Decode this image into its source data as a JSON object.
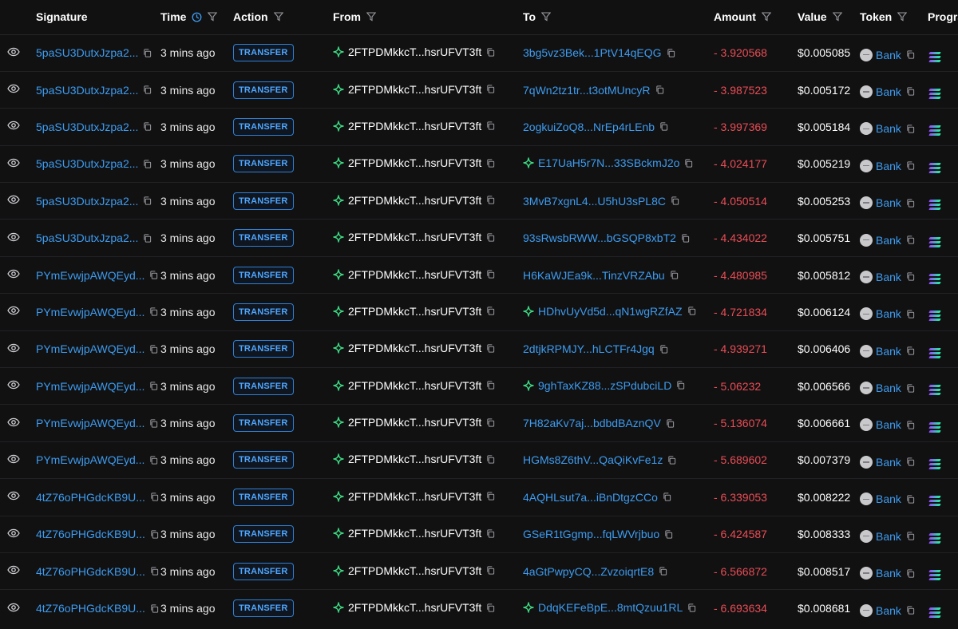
{
  "header": {
    "signature": "Signature",
    "time": "Time",
    "action": "Action",
    "from": "From",
    "to": "To",
    "amount": "Amount",
    "value": "Value",
    "token": "Token",
    "program": "Progra"
  },
  "icons": {
    "view": "eye-icon",
    "copy": "copy-icon",
    "filter": "filter-icon",
    "clock": "clock-icon",
    "wallet_verified": "sparkle-icon",
    "token": "bank-token-icon",
    "program": "solana-icon"
  },
  "colors": {
    "link": "#3d9cf0",
    "negative": "#ea4d55",
    "badge": "#2f7fd4",
    "verified": "#3ddc84",
    "background": "#111112"
  },
  "rows": [
    {
      "signature": "5paSU3DutxJzpa2...",
      "time": "3 mins ago",
      "action": "TRANSFER",
      "from": "2FTPDMkkcT...hsrUFVT3ft",
      "to": "3bg5vz3Bek...1PtV14qEQG",
      "to_verified": false,
      "amount": "- 3.920568",
      "value": "$0.005085",
      "token": "Bank"
    },
    {
      "signature": "5paSU3DutxJzpa2...",
      "time": "3 mins ago",
      "action": "TRANSFER",
      "from": "2FTPDMkkcT...hsrUFVT3ft",
      "to": "7qWn2tz1tr...t3otMUncyR",
      "to_verified": false,
      "amount": "- 3.987523",
      "value": "$0.005172",
      "token": "Bank"
    },
    {
      "signature": "5paSU3DutxJzpa2...",
      "time": "3 mins ago",
      "action": "TRANSFER",
      "from": "2FTPDMkkcT...hsrUFVT3ft",
      "to": "2ogkuiZoQ8...NrEp4rLEnb",
      "to_verified": false,
      "amount": "- 3.997369",
      "value": "$0.005184",
      "token": "Bank"
    },
    {
      "signature": "5paSU3DutxJzpa2...",
      "time": "3 mins ago",
      "action": "TRANSFER",
      "from": "2FTPDMkkcT...hsrUFVT3ft",
      "to": "E17UaH5r7N...33SBckmJ2o",
      "to_verified": true,
      "amount": "- 4.024177",
      "value": "$0.005219",
      "token": "Bank"
    },
    {
      "signature": "5paSU3DutxJzpa2...",
      "time": "3 mins ago",
      "action": "TRANSFER",
      "from": "2FTPDMkkcT...hsrUFVT3ft",
      "to": "3MvB7xgnL4...U5hU3sPL8C",
      "to_verified": false,
      "amount": "- 4.050514",
      "value": "$0.005253",
      "token": "Bank"
    },
    {
      "signature": "5paSU3DutxJzpa2...",
      "time": "3 mins ago",
      "action": "TRANSFER",
      "from": "2FTPDMkkcT...hsrUFVT3ft",
      "to": "93sRwsbRWW...bGSQP8xbT2",
      "to_verified": false,
      "amount": "- 4.434022",
      "value": "$0.005751",
      "token": "Bank"
    },
    {
      "signature": "PYmEvwjpAWQEyd...",
      "time": "3 mins ago",
      "action": "TRANSFER",
      "from": "2FTPDMkkcT...hsrUFVT3ft",
      "to": "H6KaWJEa9k...TinzVRZAbu",
      "to_verified": false,
      "amount": "- 4.480985",
      "value": "$0.005812",
      "token": "Bank"
    },
    {
      "signature": "PYmEvwjpAWQEyd...",
      "time": "3 mins ago",
      "action": "TRANSFER",
      "from": "2FTPDMkkcT...hsrUFVT3ft",
      "to": "HDhvUyVd5d...qN1wgRZfAZ",
      "to_verified": true,
      "amount": "- 4.721834",
      "value": "$0.006124",
      "token": "Bank"
    },
    {
      "signature": "PYmEvwjpAWQEyd...",
      "time": "3 mins ago",
      "action": "TRANSFER",
      "from": "2FTPDMkkcT...hsrUFVT3ft",
      "to": "2dtjkRPMJY...hLCTFr4Jgq",
      "to_verified": false,
      "amount": "- 4.939271",
      "value": "$0.006406",
      "token": "Bank"
    },
    {
      "signature": "PYmEvwjpAWQEyd...",
      "time": "3 mins ago",
      "action": "TRANSFER",
      "from": "2FTPDMkkcT...hsrUFVT3ft",
      "to": "9ghTaxKZ88...zSPdubciLD",
      "to_verified": true,
      "amount": "- 5.06232",
      "value": "$0.006566",
      "token": "Bank"
    },
    {
      "signature": "PYmEvwjpAWQEyd...",
      "time": "3 mins ago",
      "action": "TRANSFER",
      "from": "2FTPDMkkcT...hsrUFVT3ft",
      "to": "7H82aKv7aj...bdbdBAznQV",
      "to_verified": false,
      "amount": "- 5.136074",
      "value": "$0.006661",
      "token": "Bank"
    },
    {
      "signature": "PYmEvwjpAWQEyd...",
      "time": "3 mins ago",
      "action": "TRANSFER",
      "from": "2FTPDMkkcT...hsrUFVT3ft",
      "to": "HGMs8Z6thV...QaQiKvFe1z",
      "to_verified": false,
      "amount": "- 5.689602",
      "value": "$0.007379",
      "token": "Bank"
    },
    {
      "signature": "4tZ76oPHGdcKB9U...",
      "time": "3 mins ago",
      "action": "TRANSFER",
      "from": "2FTPDMkkcT...hsrUFVT3ft",
      "to": "4AQHLsut7a...iBnDtgzCCo",
      "to_verified": false,
      "amount": "- 6.339053",
      "value": "$0.008222",
      "token": "Bank"
    },
    {
      "signature": "4tZ76oPHGdcKB9U...",
      "time": "3 mins ago",
      "action": "TRANSFER",
      "from": "2FTPDMkkcT...hsrUFVT3ft",
      "to": "GSeR1tGgmp...fqLWVrjbuo",
      "to_verified": false,
      "amount": "- 6.424587",
      "value": "$0.008333",
      "token": "Bank"
    },
    {
      "signature": "4tZ76oPHGdcKB9U...",
      "time": "3 mins ago",
      "action": "TRANSFER",
      "from": "2FTPDMkkcT...hsrUFVT3ft",
      "to": "4aGtPwpyCQ...ZvzoiqrtE8",
      "to_verified": false,
      "amount": "- 6.566872",
      "value": "$0.008517",
      "token": "Bank"
    },
    {
      "signature": "4tZ76oPHGdcKB9U...",
      "time": "3 mins ago",
      "action": "TRANSFER",
      "from": "2FTPDMkkcT...hsrUFVT3ft",
      "to": "DdqKEFeBpE...8mtQzuu1RL",
      "to_verified": true,
      "amount": "- 6.693634",
      "value": "$0.008681",
      "token": "Bank"
    }
  ]
}
